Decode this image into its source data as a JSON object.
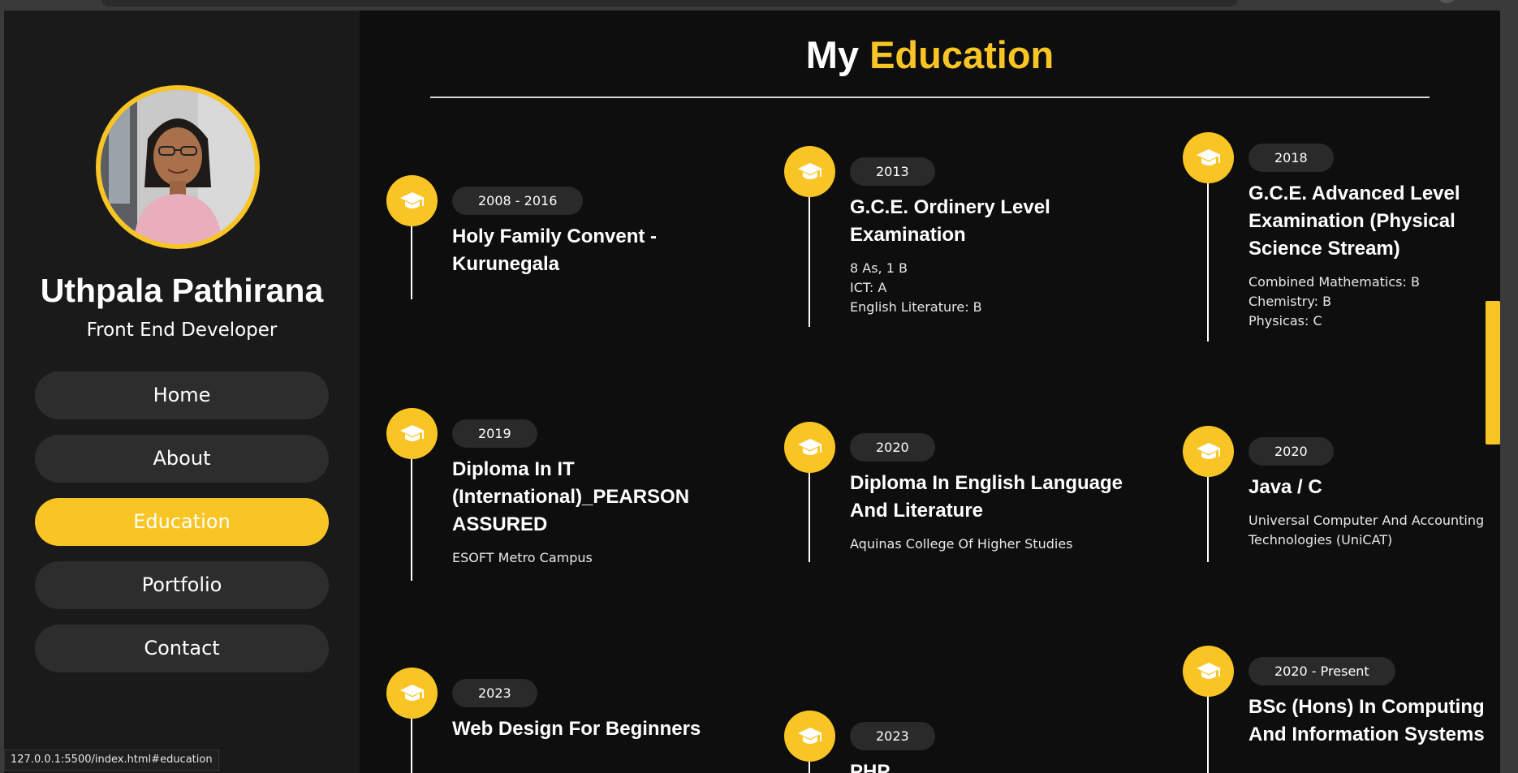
{
  "status_url": "127.0.0.1:5500/index.html#education",
  "colors": {
    "accent": "#f9c524",
    "background": "#0e0e0e",
    "sidebar": "#1a1a1a"
  },
  "profile": {
    "name": "Uthpala Pathirana",
    "role": "Front End Developer",
    "avatar_icon": "profile-photo"
  },
  "nav": {
    "items": [
      {
        "label": "Home",
        "active": false
      },
      {
        "label": "About",
        "active": false
      },
      {
        "label": "Education",
        "active": true
      },
      {
        "label": "Portfolio",
        "active": false
      },
      {
        "label": "Contact",
        "active": false
      }
    ]
  },
  "main": {
    "title_prefix": "My",
    "title_accent": "Education",
    "icon": "graduation-cap-icon",
    "items": [
      {
        "year": "2008 - 2016",
        "title": "Holy Family Convent - Kurunegala",
        "details": []
      },
      {
        "year": "2013",
        "title": "G.C.E. Ordinery Level Examination",
        "details": [
          "8 As, 1 B",
          "ICT: A",
          "English Literature: B"
        ]
      },
      {
        "year": "2018",
        "title": "G.C.E. Advanced Level Examination (Physical Science Stream)",
        "details": [
          "Combined Mathematics: B",
          "Chemistry: B",
          "Physicas: C"
        ]
      },
      {
        "year": "2019",
        "title": "Diploma In IT (International)_PEARSON ASSURED",
        "details": [
          "ESOFT Metro Campus"
        ]
      },
      {
        "year": "2020",
        "title": "Diploma In English Language And Literature",
        "details": [
          "Aquinas College Of Higher Studies"
        ]
      },
      {
        "year": "2020",
        "title": "Java / C",
        "details": [
          "Universal Computer And Accounting Technologies (UniCAT)"
        ]
      },
      {
        "year": "2023",
        "title": "Web Design For Beginners",
        "details": []
      },
      {
        "year": "2023",
        "title": "PHP",
        "details": []
      },
      {
        "year": "2020 - Present",
        "title": "BSc (Hons) In Computing And Information Systems",
        "details": []
      }
    ]
  }
}
